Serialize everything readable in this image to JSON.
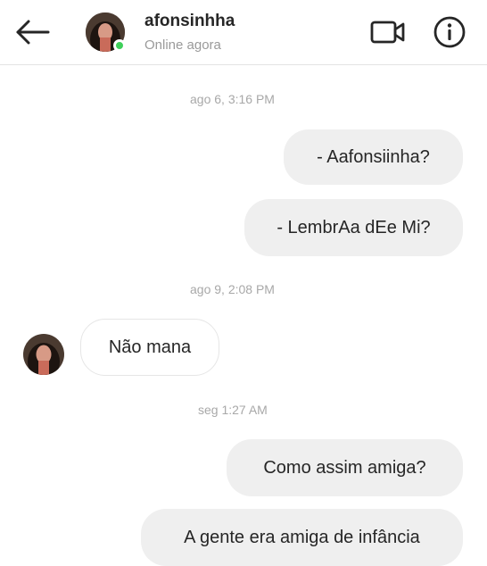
{
  "header": {
    "username": "afonsinhha",
    "status": "Online agora",
    "back_icon": "arrow-left-icon",
    "video_icon": "video-camera-icon",
    "info_icon": "info-icon"
  },
  "thread": {
    "timestamps": [
      "ago 6, 3:16 PM",
      "ago 9, 2:08 PM",
      "seg 1:27 AM"
    ],
    "messages": [
      {
        "side": "sent",
        "text": "- Aafonsiinha?"
      },
      {
        "side": "sent",
        "text": "- LembrAa dEe Mi?"
      },
      {
        "side": "received",
        "text": "Não mana"
      },
      {
        "side": "sent",
        "text": "Como assim amiga?"
      },
      {
        "side": "sent",
        "text": "A gente era amiga de infância"
      }
    ]
  },
  "colors": {
    "sent_bubble": "#efefef",
    "received_bubble": "#ffffff",
    "online": "#3fcf5a",
    "timestamp": "#a8a8a8"
  }
}
